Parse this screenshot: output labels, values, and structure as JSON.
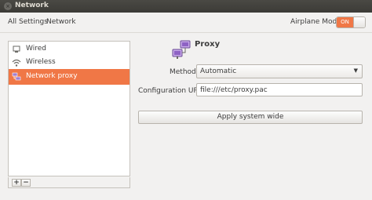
{
  "window": {
    "title": "Network"
  },
  "toolbar": {
    "breadcrumb_all": "All Settings",
    "breadcrumb_current": "Network",
    "airplane_label": "Airplane Mode",
    "airplane_state": "ON"
  },
  "sidebar": {
    "items": [
      {
        "label": "Wired",
        "icon": "wired-icon"
      },
      {
        "label": "Wireless",
        "icon": "wifi-icon"
      },
      {
        "label": "Network proxy",
        "icon": "proxy-icon"
      }
    ],
    "selected_index": 2,
    "add_label": "+",
    "remove_label": "−"
  },
  "proxy": {
    "title": "Proxy",
    "method_label": "Method",
    "method_value": "Automatic",
    "config_label": "Configuration URL",
    "config_value": "file:///etc/proxy.pac",
    "apply_label": "Apply system wide"
  },
  "colors": {
    "accent": "#f07746",
    "titlebar": "#3c3b37",
    "background": "#f2f1f0"
  }
}
